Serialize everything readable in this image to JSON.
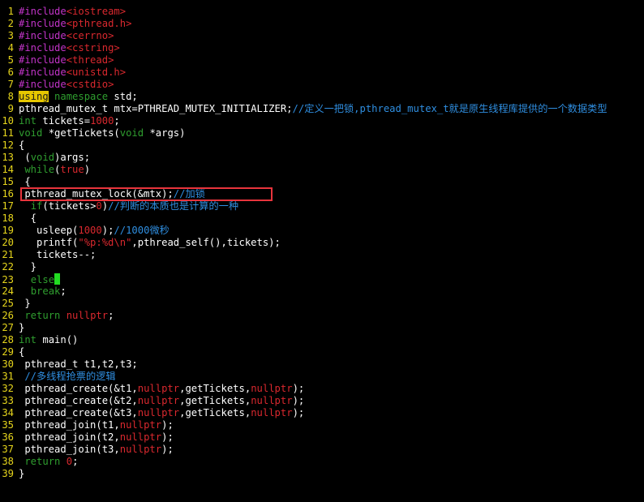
{
  "editor": {
    "lines": [
      {
        "num": "1",
        "tokens": [
          {
            "t": "#include",
            "c": "preproc"
          },
          {
            "t": "<iostream>",
            "c": "string"
          }
        ]
      },
      {
        "num": "2",
        "tokens": [
          {
            "t": "#include",
            "c": "preproc"
          },
          {
            "t": "<pthread.h>",
            "c": "string"
          }
        ]
      },
      {
        "num": "3",
        "tokens": [
          {
            "t": "#include",
            "c": "preproc"
          },
          {
            "t": "<cerrno>",
            "c": "string"
          }
        ]
      },
      {
        "num": "4",
        "tokens": [
          {
            "t": "#include",
            "c": "preproc"
          },
          {
            "t": "<cstring>",
            "c": "string"
          }
        ]
      },
      {
        "num": "5",
        "tokens": [
          {
            "t": "#include",
            "c": "preproc"
          },
          {
            "t": "<thread>",
            "c": "string"
          }
        ]
      },
      {
        "num": "6",
        "tokens": [
          {
            "t": "#include",
            "c": "preproc"
          },
          {
            "t": "<unistd.h>",
            "c": "string"
          }
        ]
      },
      {
        "num": "7",
        "tokens": [
          {
            "t": "#include",
            "c": "preproc"
          },
          {
            "t": "<cstdio>",
            "c": "string"
          }
        ]
      },
      {
        "num": "8",
        "tokens": [
          {
            "t": "using",
            "c": "keyword-hl"
          },
          {
            "t": " ",
            "c": "default"
          },
          {
            "t": "namespace",
            "c": "keyword"
          },
          {
            "t": " std;",
            "c": "default"
          }
        ]
      },
      {
        "num": "9",
        "tokens": [
          {
            "t": "pthread_mutex_t mtx=PTHREAD_MUTEX_INITIALIZER;",
            "c": "default"
          },
          {
            "t": "//定义一把锁,pthread_mutex_t就是原生线程库提供的一个数据类型",
            "c": "comment"
          }
        ]
      },
      {
        "num": "10",
        "tokens": [
          {
            "t": "int",
            "c": "keyword"
          },
          {
            "t": " tickets=",
            "c": "default"
          },
          {
            "t": "1000",
            "c": "number"
          },
          {
            "t": ";",
            "c": "default"
          }
        ]
      },
      {
        "num": "11",
        "tokens": [
          {
            "t": "void",
            "c": "keyword"
          },
          {
            "t": " *getTickets(",
            "c": "default"
          },
          {
            "t": "void",
            "c": "keyword"
          },
          {
            "t": " *args)",
            "c": "default"
          }
        ]
      },
      {
        "num": "12",
        "tokens": [
          {
            "t": "{",
            "c": "default"
          }
        ]
      },
      {
        "num": "13",
        "tokens": [
          {
            "t": " (",
            "c": "default"
          },
          {
            "t": "void",
            "c": "keyword"
          },
          {
            "t": ")args;",
            "c": "default"
          }
        ]
      },
      {
        "num": "14",
        "tokens": [
          {
            "t": " ",
            "c": "default"
          },
          {
            "t": "while",
            "c": "keyword"
          },
          {
            "t": "(",
            "c": "default"
          },
          {
            "t": "true",
            "c": "number"
          },
          {
            "t": ")",
            "c": "default"
          }
        ]
      },
      {
        "num": "15",
        "tokens": [
          {
            "t": " {",
            "c": "default"
          }
        ]
      },
      {
        "num": "16",
        "tokens": [
          {
            "t": " pthread_mutex_lock(&mtx);",
            "c": "default"
          },
          {
            "t": "//加锁",
            "c": "comment"
          }
        ]
      },
      {
        "num": "17",
        "tokens": [
          {
            "t": "  ",
            "c": "default"
          },
          {
            "t": "if",
            "c": "keyword"
          },
          {
            "t": "(tickets>",
            "c": "default"
          },
          {
            "t": "0",
            "c": "number"
          },
          {
            "t": ")",
            "c": "default"
          },
          {
            "t": "//判断的本质也是计算的一种",
            "c": "comment"
          }
        ]
      },
      {
        "num": "18",
        "tokens": [
          {
            "t": "  {",
            "c": "default"
          }
        ]
      },
      {
        "num": "19",
        "tokens": [
          {
            "t": "   usleep(",
            "c": "default"
          },
          {
            "t": "1000",
            "c": "number"
          },
          {
            "t": ");",
            "c": "default"
          },
          {
            "t": "//1000微秒",
            "c": "comment"
          }
        ]
      },
      {
        "num": "20",
        "tokens": [
          {
            "t": "   printf(",
            "c": "default"
          },
          {
            "t": "\"%p:%d\\n\"",
            "c": "string"
          },
          {
            "t": ",pthread_self(),tickets);",
            "c": "default"
          }
        ]
      },
      {
        "num": "21",
        "tokens": [
          {
            "t": "   tickets--;",
            "c": "default"
          }
        ]
      },
      {
        "num": "22",
        "tokens": [
          {
            "t": "  }",
            "c": "default"
          }
        ]
      },
      {
        "num": "23",
        "tokens": [
          {
            "t": "  ",
            "c": "default"
          },
          {
            "t": "else",
            "c": "keyword"
          },
          {
            "t": "",
            "c": "cursor"
          }
        ]
      },
      {
        "num": "24",
        "tokens": [
          {
            "t": "  ",
            "c": "default"
          },
          {
            "t": "break",
            "c": "keyword"
          },
          {
            "t": ";",
            "c": "default"
          }
        ]
      },
      {
        "num": "25",
        "tokens": [
          {
            "t": " }",
            "c": "default"
          }
        ]
      },
      {
        "num": "26",
        "tokens": [
          {
            "t": " ",
            "c": "default"
          },
          {
            "t": "return",
            "c": "keyword"
          },
          {
            "t": " ",
            "c": "default"
          },
          {
            "t": "nullptr",
            "c": "number"
          },
          {
            "t": ";",
            "c": "default"
          }
        ]
      },
      {
        "num": "27",
        "tokens": [
          {
            "t": "}",
            "c": "default"
          }
        ]
      },
      {
        "num": "28",
        "tokens": [
          {
            "t": "int",
            "c": "keyword"
          },
          {
            "t": " main()",
            "c": "default"
          }
        ]
      },
      {
        "num": "29",
        "tokens": [
          {
            "t": "{",
            "c": "default"
          }
        ]
      },
      {
        "num": "30",
        "tokens": [
          {
            "t": " pthread_t t1,t2,t3;",
            "c": "default"
          }
        ]
      },
      {
        "num": "31",
        "tokens": [
          {
            "t": " ",
            "c": "default"
          },
          {
            "t": "//多线程抢票的逻辑",
            "c": "comment"
          }
        ]
      },
      {
        "num": "32",
        "tokens": [
          {
            "t": " pthread_create(&t1,",
            "c": "default"
          },
          {
            "t": "nullptr",
            "c": "number"
          },
          {
            "t": ",getTickets,",
            "c": "default"
          },
          {
            "t": "nullptr",
            "c": "number"
          },
          {
            "t": ");",
            "c": "default"
          }
        ]
      },
      {
        "num": "33",
        "tokens": [
          {
            "t": " pthread_create(&t2,",
            "c": "default"
          },
          {
            "t": "nullptr",
            "c": "number"
          },
          {
            "t": ",getTickets,",
            "c": "default"
          },
          {
            "t": "nullptr",
            "c": "number"
          },
          {
            "t": ");",
            "c": "default"
          }
        ]
      },
      {
        "num": "34",
        "tokens": [
          {
            "t": " pthread_create(&t3,",
            "c": "default"
          },
          {
            "t": "nullptr",
            "c": "number"
          },
          {
            "t": ",getTickets,",
            "c": "default"
          },
          {
            "t": "nullptr",
            "c": "number"
          },
          {
            "t": ");",
            "c": "default"
          }
        ]
      },
      {
        "num": "35",
        "tokens": [
          {
            "t": " pthread_join(t1,",
            "c": "default"
          },
          {
            "t": "nullptr",
            "c": "number"
          },
          {
            "t": ");",
            "c": "default"
          }
        ]
      },
      {
        "num": "36",
        "tokens": [
          {
            "t": " pthread_join(t2,",
            "c": "default"
          },
          {
            "t": "nullptr",
            "c": "number"
          },
          {
            "t": ");",
            "c": "default"
          }
        ]
      },
      {
        "num": "37",
        "tokens": [
          {
            "t": " pthread_join(t3,",
            "c": "default"
          },
          {
            "t": "nullptr",
            "c": "number"
          },
          {
            "t": ");",
            "c": "default"
          }
        ]
      },
      {
        "num": "38",
        "tokens": [
          {
            "t": " ",
            "c": "default"
          },
          {
            "t": "return",
            "c": "keyword"
          },
          {
            "t": " ",
            "c": "default"
          },
          {
            "t": "0",
            "c": "number"
          },
          {
            "t": ";",
            "c": "default"
          }
        ]
      },
      {
        "num": "39",
        "tokens": [
          {
            "t": "}",
            "c": "default"
          }
        ]
      }
    ],
    "highlighted_line": "16"
  },
  "colors": {
    "background": "#000000",
    "line_number": "#e6d51c",
    "preprocessor": "#c234c8",
    "string": "#d9282e",
    "keyword": "#2f9e2f",
    "comment": "#2f8ee0",
    "cursor": "#22dd22",
    "annotation_box": "#e8343c"
  }
}
